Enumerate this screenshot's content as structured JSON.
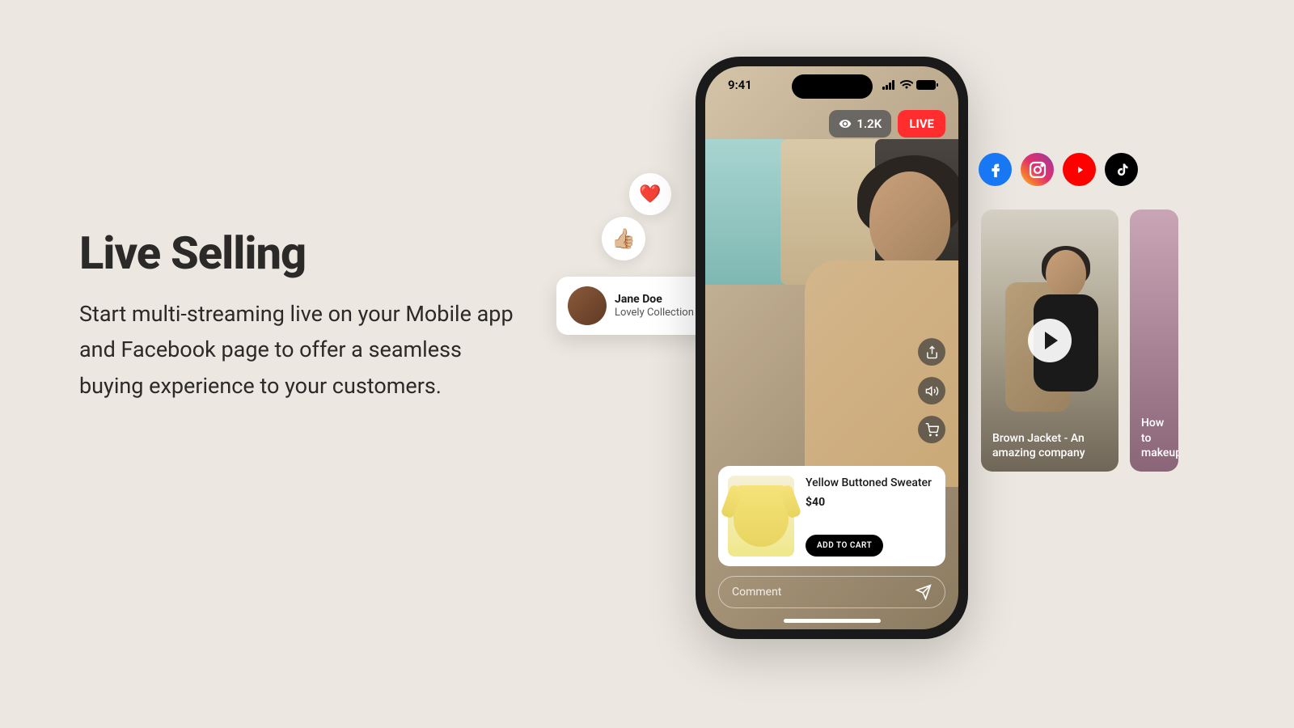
{
  "hero": {
    "title": "Live Selling",
    "description": "Start multi-streaming live on your Mobile app and Facebook page to offer a seamless buying experience to your customers."
  },
  "phone": {
    "time": "9:41",
    "viewers": "1.2K",
    "live_label": "LIVE",
    "product": {
      "name": "Yellow Buttoned Sweater",
      "price": "$40",
      "cta": "ADD TO CART"
    },
    "comment_placeholder": "Comment"
  },
  "chat": {
    "name": "Jane Doe",
    "message": "Lovely Collection ❤️"
  },
  "reactions": {
    "heart": "❤️",
    "thumb": "👍🏼"
  },
  "social": [
    "facebook",
    "instagram",
    "youtube",
    "tiktok"
  ],
  "video_cards": [
    {
      "title": "Brown Jacket  - An amazing company"
    },
    {
      "title": "How to makeup"
    }
  ]
}
